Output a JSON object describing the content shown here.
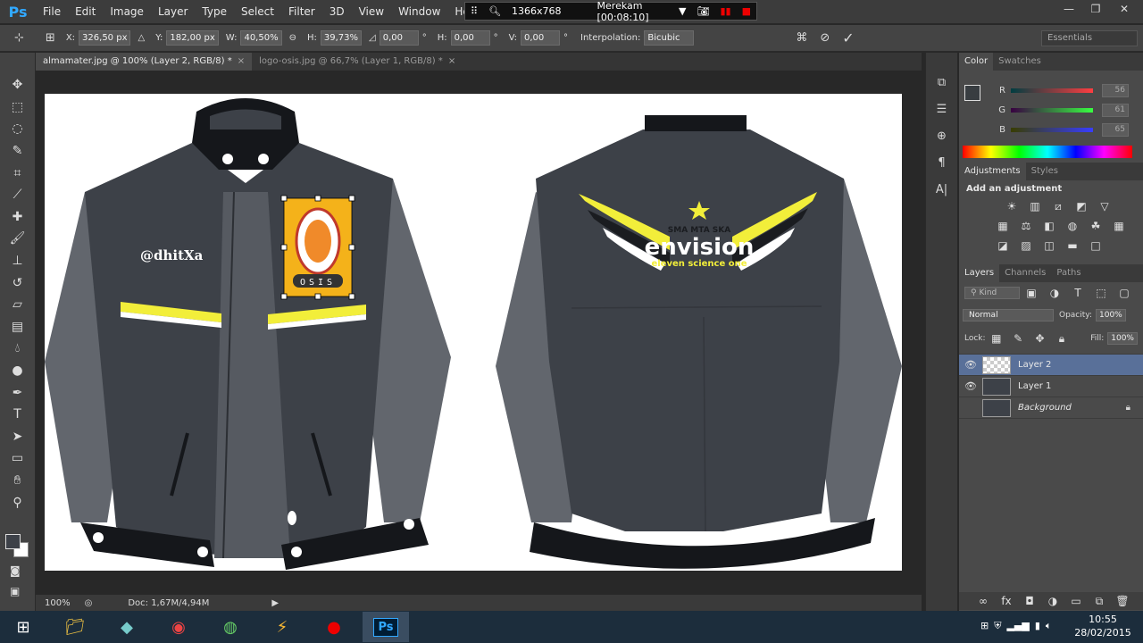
{
  "app": {
    "logo": "Ps"
  },
  "menu": [
    "File",
    "Edit",
    "Image",
    "Layer",
    "Type",
    "Select",
    "Filter",
    "3D",
    "View",
    "Window",
    "Help"
  ],
  "recorder": {
    "resolution": "1366x768",
    "status": "Merekam [00:08:10]"
  },
  "options_bar": {
    "x_label": "X:",
    "x_value": "326,50 px",
    "y_label": "Y:",
    "y_value": "182,00 px",
    "w_label": "W:",
    "w_value": "40,50%",
    "h_label": "H:",
    "h_value": "39,73%",
    "angle_value": "0,00",
    "angle_unit": "°",
    "hskew_label": "H:",
    "hskew_value": "0,00",
    "hskew_unit": "°",
    "vskew_label": "V:",
    "vskew_value": "0,00",
    "vskew_unit": "°",
    "interp_label": "Interpolation:",
    "interp_value": "Bicubic"
  },
  "workspace": "Essentials",
  "tabs": [
    {
      "label": "almamater.jpg @ 100% (Layer 2, RGB/8) *",
      "close": "×"
    },
    {
      "label": "logo-osis.jpg @ 66,7% (Layer 1, RGB/8) *",
      "close": "×"
    }
  ],
  "artwork": {
    "front_text": "@dhitXa",
    "patch_text": "OSIS",
    "back_small": "SMA MTA SKA",
    "back_title": "envision",
    "back_sub": "eleven science one"
  },
  "status": {
    "zoom": "100%",
    "doc": "Doc: 1,67M/4,94M"
  },
  "color_panel": {
    "tabs": [
      "Color",
      "Swatches"
    ],
    "sliders": [
      {
        "label": "R",
        "value": "56"
      },
      {
        "label": "G",
        "value": "61"
      },
      {
        "label": "B",
        "value": "65"
      }
    ],
    "fg_color": "#383d41"
  },
  "adjustments_panel": {
    "tabs": [
      "Adjustments",
      "Styles"
    ],
    "heading": "Add an adjustment"
  },
  "layers_panel": {
    "tabs": [
      "Layers",
      "Channels",
      "Paths"
    ],
    "kind": "Kind",
    "blend": "Normal",
    "opacity_label": "Opacity:",
    "opacity": "100%",
    "lock_label": "Lock:",
    "fill_label": "Fill:",
    "fill": "100%",
    "layers": [
      {
        "name": "Layer 2",
        "visible": true,
        "selected": true
      },
      {
        "name": "Layer 1",
        "visible": true,
        "selected": false
      },
      {
        "name": "Background",
        "visible": false,
        "selected": false,
        "locked": true
      }
    ]
  },
  "taskbar": {
    "time": "10:55",
    "date": "28/02/2015",
    "ps_label": "Ps"
  },
  "colors": {
    "accent_yellow": "#f2ee3a",
    "jacket_dark": "#3d4148",
    "jacket_sleeve": "#62666d",
    "jacket_black": "#15171b",
    "selection_blue": "#597099"
  }
}
